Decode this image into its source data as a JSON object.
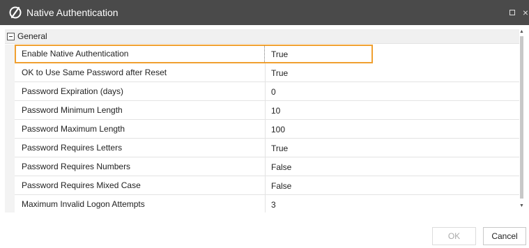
{
  "window": {
    "title": "Native Authentication",
    "icon": "brand-logo-icon",
    "title_bar_color": "#4a4a4a"
  },
  "group": {
    "label": "General",
    "expanded": true
  },
  "properties": [
    {
      "name": "Enable Native Authentication",
      "value": "True",
      "selected": true
    },
    {
      "name": "OK to Use Same Password after Reset",
      "value": "True"
    },
    {
      "name": "Password Expiration (days)",
      "value": "0"
    },
    {
      "name": "Password Minimum Length",
      "value": "10"
    },
    {
      "name": "Password Maximum Length",
      "value": "100"
    },
    {
      "name": "Password Requires Letters",
      "value": "True"
    },
    {
      "name": "Password Requires Numbers",
      "value": "False"
    },
    {
      "name": "Password Requires Mixed Case",
      "value": "False"
    },
    {
      "name": "Maximum Invalid Logon Attempts",
      "value": "3"
    }
  ],
  "buttons": {
    "ok": "OK",
    "cancel": "Cancel"
  },
  "colors": {
    "selection_border": "#f0a030"
  }
}
